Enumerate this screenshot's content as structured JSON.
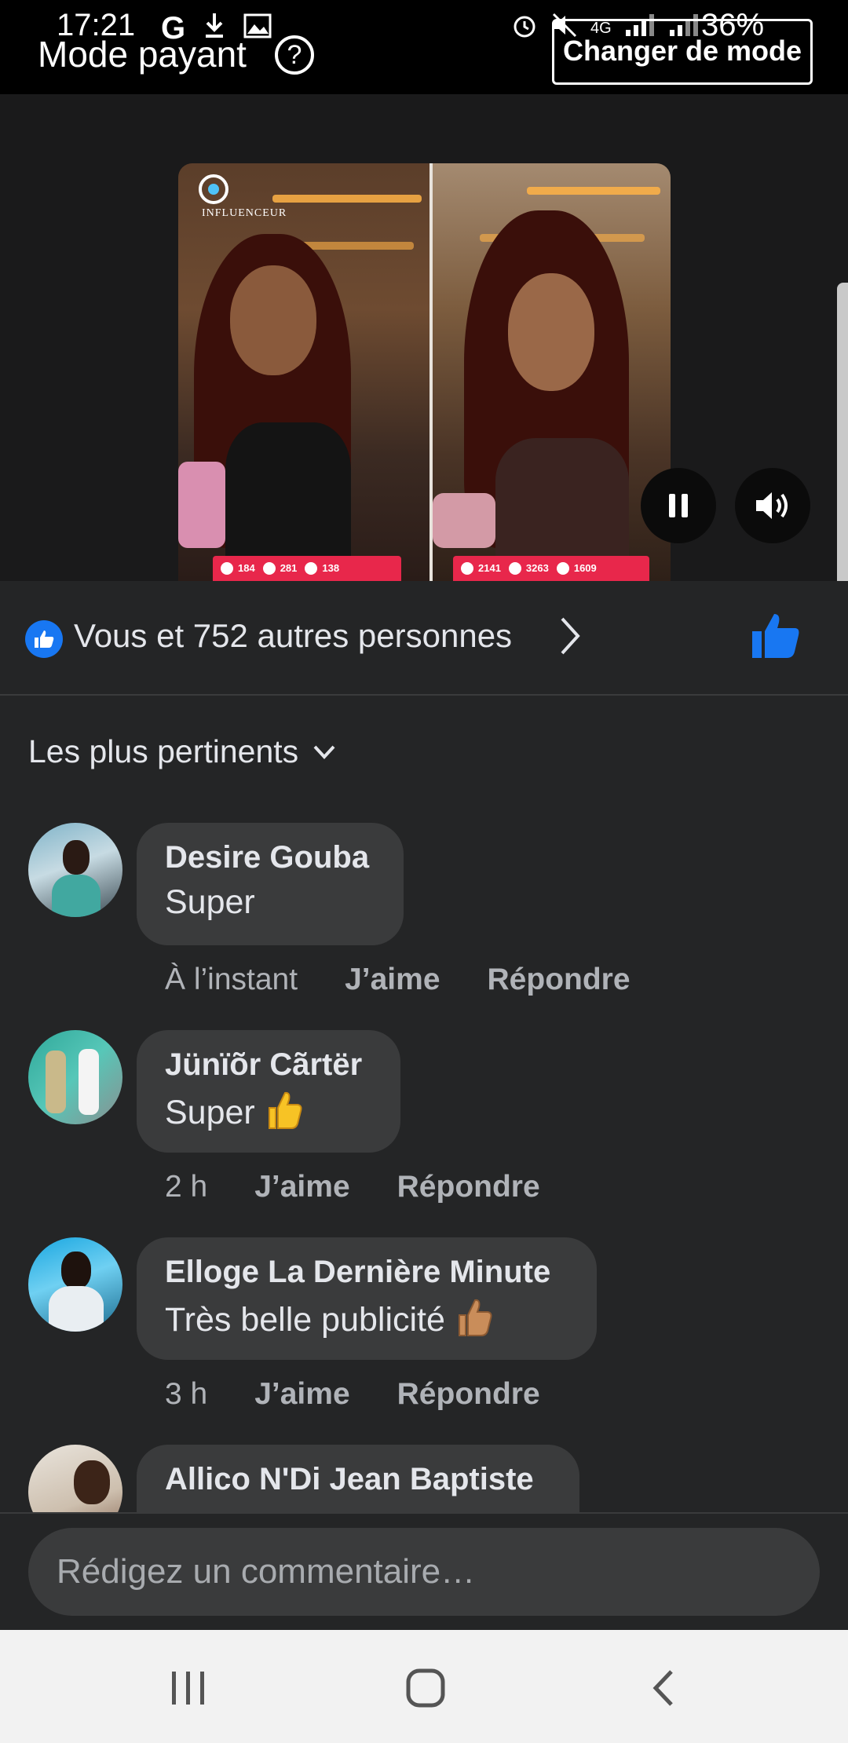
{
  "status_bar": {
    "time": "17:21",
    "left_icons": [
      "google-icon",
      "download-icon",
      "image-icon"
    ],
    "right_icons": [
      "alarm-icon",
      "mute-icon",
      "4g-lte-icon",
      "signal-icon",
      "signal-icon"
    ],
    "battery": "36%"
  },
  "mode_bar": {
    "title": "Mode payant",
    "help_label": "?",
    "switch_label": "Changer de mode"
  },
  "video": {
    "logo_text": "INFLUENCEUR",
    "left_stats": [
      "184",
      "281",
      "138"
    ],
    "right_stats": [
      "2141",
      "3263",
      "1609"
    ],
    "state": "playing",
    "colors": {
      "stat_bar": "#e8274b"
    }
  },
  "likes": {
    "summary": "Vous et 752 autres personnes",
    "colors": {
      "like_blue": "#1877f2"
    }
  },
  "sort": {
    "label": "Les plus pertinents"
  },
  "comments": [
    {
      "author": "Desire Gouba",
      "text": "Super",
      "time": "À l’instant",
      "like_label": "J’aime",
      "reply_label": "Répondre"
    },
    {
      "author": "Jünïõr Cãrtër",
      "text": "Super",
      "emoji": "thumbs-up",
      "time": "2 h",
      "like_label": "J’aime",
      "reply_label": "Répondre"
    },
    {
      "author": "Elloge La Dernière Minute",
      "text": "Très belle publicité",
      "emoji": "thumbs-up-medium-skin",
      "time": "3 h",
      "like_label": "J’aime",
      "reply_label": "Répondre"
    },
    {
      "author": "Allico N'Di Jean Baptiste"
    }
  ],
  "composer": {
    "placeholder": "Rédigez un commentaire…"
  },
  "colors": {
    "background": "#242526",
    "bubble": "#3a3b3c",
    "secondary_text": "#b0b3b8"
  }
}
